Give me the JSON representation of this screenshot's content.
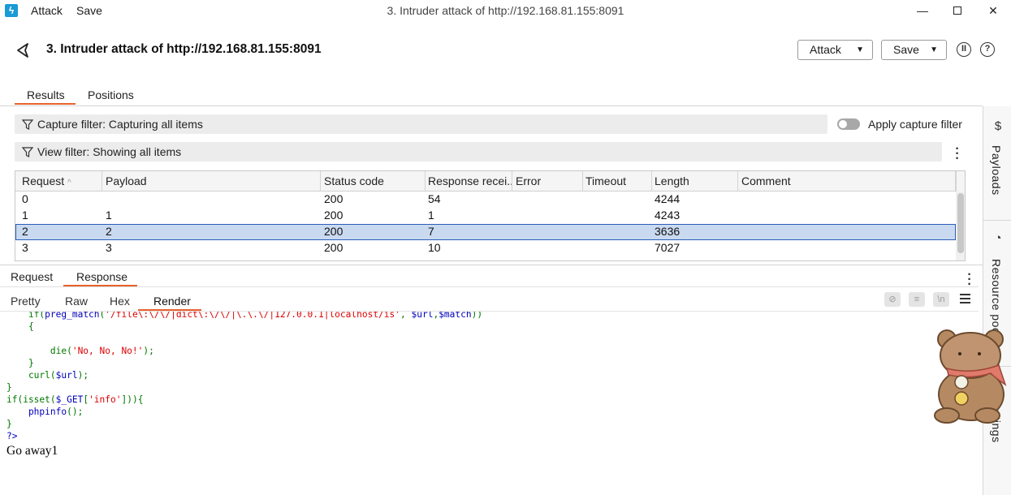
{
  "window": {
    "menu_attack": "Attack",
    "menu_save": "Save",
    "title": "3. Intruder attack of http://192.168.81.155:8091",
    "min_glyph": "—",
    "close_glyph": "✕"
  },
  "header": {
    "title": "3. Intruder attack of http://192.168.81.155:8091",
    "attack_label": "Attack",
    "save_label": "Save"
  },
  "tabs": {
    "results": "Results",
    "positions": "Positions"
  },
  "filters": {
    "capture": "Capture filter: Capturing all items",
    "view": "View filter: Showing all items",
    "apply_capture": "Apply capture filter"
  },
  "table": {
    "columns": [
      "Request",
      "Payload",
      "Status code",
      "Response recei...",
      "Error",
      "Timeout",
      "Length",
      "Comment"
    ],
    "rows": [
      {
        "request": "0",
        "payload": "",
        "status": "200",
        "response": "54",
        "length": "4244"
      },
      {
        "request": "1",
        "payload": "1",
        "status": "200",
        "response": "1",
        "length": "4243"
      },
      {
        "request": "2",
        "payload": "2",
        "status": "200",
        "response": "7",
        "length": "3636"
      },
      {
        "request": "3",
        "payload": "3",
        "status": "200",
        "response": "10",
        "length": "7027"
      }
    ],
    "selected_row": 2
  },
  "message_tabs": {
    "request": "Request",
    "response": "Response"
  },
  "view_tabs": {
    "pretty": "Pretty",
    "raw": "Raw",
    "hex": "Hex",
    "render": "Render"
  },
  "sidebar": {
    "payloads": "Payloads",
    "resource_pool": "Resource pool",
    "settings": "Settings"
  },
  "code": {
    "l1_indent": "    ",
    "l1_kw": "if(",
    "l1_fn": "preg_match",
    "l1_kw2": "(",
    "l1_str": "'/file\\:\\/\\/|dict\\:\\/\\/|\\.\\.\\/|127.0.0.1|localhost/is'",
    "l1_kw3": ", ",
    "l1_fn2": "$url",
    "l1_kw4": ",",
    "l1_fn3": "$match",
    "l1_kw5": "))",
    "l2": "    {",
    "l4_kw": "        die(",
    "l4_str": "'No, No, No!'",
    "l4_end": ");",
    "l5": "    }",
    "l6_a": "    curl(",
    "l6_fn": "$url",
    "l6_b": ");",
    "l7": "}",
    "l8_a": "if(isset(",
    "l8_fn": "$_GET",
    "l8_b": "[",
    "l8_str": "'info'",
    "l8_c": "])){",
    "l9_fn": "    phpinfo",
    "l9_b": "();",
    "l10": "}",
    "l11": "?>",
    "output": "Go away1"
  },
  "colors": {
    "accent": "#e8612c",
    "selection": "#c9d9f0",
    "php_keyword": "#007700",
    "php_default": "#0000bb",
    "php_string": "#dd0000"
  }
}
